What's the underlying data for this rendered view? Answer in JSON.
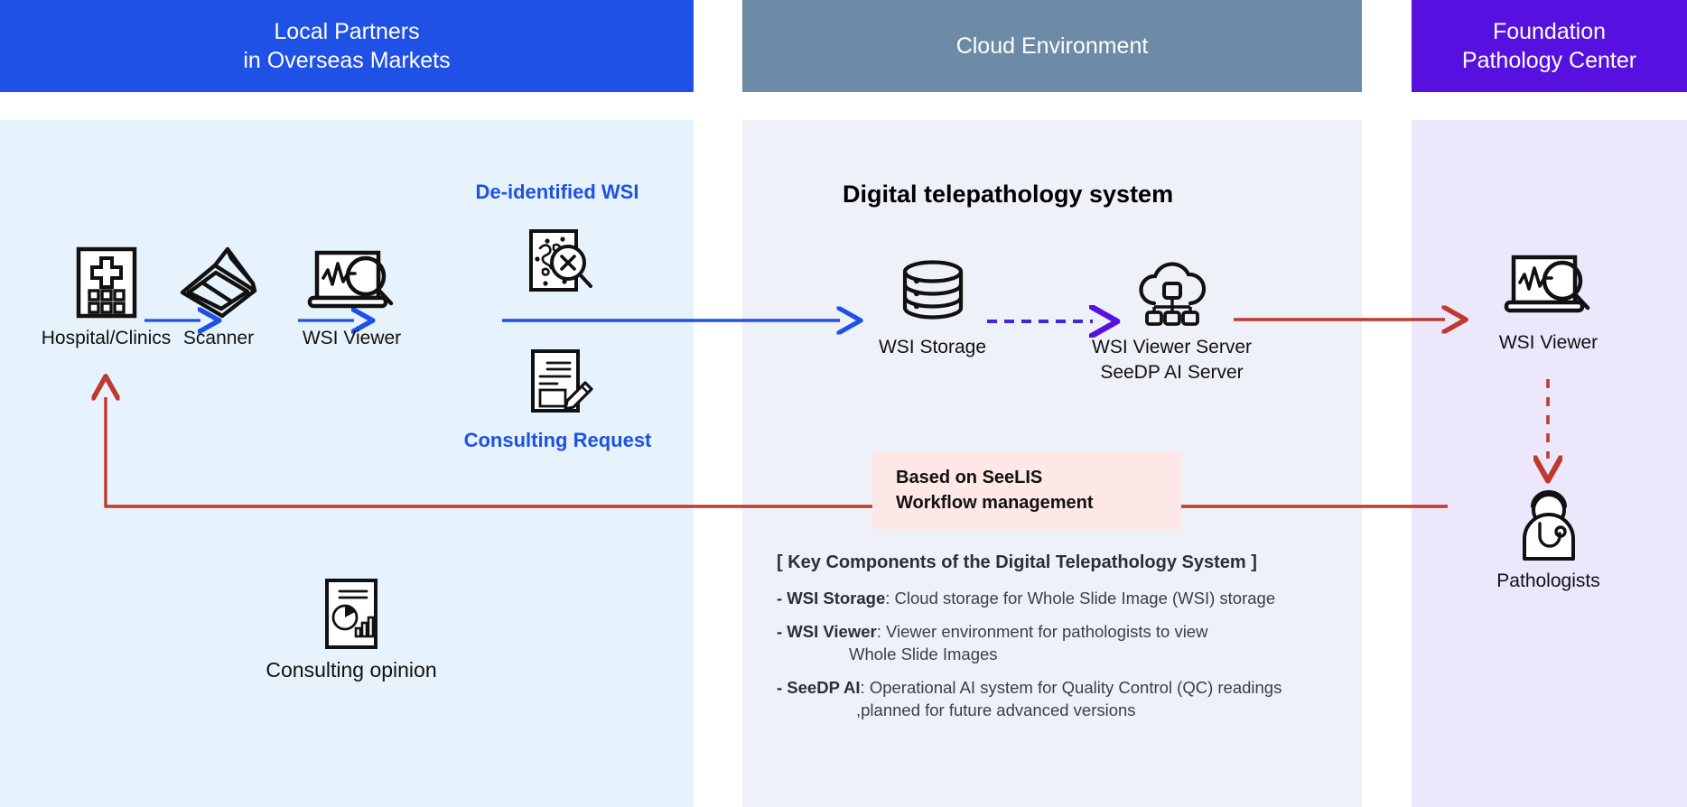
{
  "headers": [
    {
      "id": "local-partners",
      "line1": "Local Partners",
      "line2": "in Overseas Markets",
      "color": "#1f51e6"
    },
    {
      "id": "cloud-environment",
      "line1": "Cloud Environment",
      "line2": "",
      "color": "#6d8aa6"
    },
    {
      "id": "foundation-pathology-center",
      "line1": "Foundation",
      "line2": "Pathology Center",
      "color": "#5611e0"
    }
  ],
  "left_panel": {
    "nodes": [
      {
        "id": "hospital-clinics",
        "label": "Hospital/Clinics",
        "icon": "hospital-icon"
      },
      {
        "id": "scanner",
        "label": "Scanner",
        "icon": "scanner-icon"
      },
      {
        "id": "wsi-viewer",
        "label": "WSI Viewer",
        "icon": "wsi-viewer-icon"
      },
      {
        "id": "consulting-opinion",
        "label": "Consulting opinion",
        "icon": "report-chart-icon"
      }
    ],
    "flow_labels": {
      "deidentified": "De-identified WSI",
      "consulting_request": "Consulting Request"
    },
    "flow_icons": [
      {
        "id": "deidentified-wsi",
        "icon": "slide-anonymize-icon"
      },
      {
        "id": "consulting-request",
        "icon": "document-pen-icon"
      }
    ]
  },
  "center_panel": {
    "title": "Digital telepathology system",
    "nodes": [
      {
        "id": "wsi-storage",
        "label": "WSI Storage",
        "icon": "database-icon"
      },
      {
        "id": "wsi-viewer-server",
        "label_line1": "WSI Viewer Server",
        "label_line2": "SeeDP AI Server",
        "icon": "cloud-server-icon"
      }
    ],
    "pink_box": {
      "line1": "Based on SeeLIS",
      "line2": "Workflow management",
      "bg": "#fde8e7"
    },
    "key_components": {
      "title": "[ Key Components of the Digital Telepathology System ]",
      "items": [
        {
          "term": "- WSI Storage",
          "desc": ": Cloud storage for Whole Slide Image (WSI) storage",
          "cont": ""
        },
        {
          "term": "- WSI Viewer",
          "desc": ": Viewer environment for pathologists to view",
          "cont": "Whole Slide Images"
        },
        {
          "term": "- SeeDP AI",
          "desc": ": Operational AI system for Quality Control (QC) readings",
          "cont": ",planned for future advanced versions"
        }
      ]
    }
  },
  "right_panel": {
    "nodes": [
      {
        "id": "wsi-viewer-right",
        "label": "WSI Viewer",
        "icon": "wsi-viewer-icon"
      },
      {
        "id": "pathologists",
        "label": "Pathologists",
        "icon": "pathologist-icon"
      }
    ]
  },
  "colors": {
    "blue_accent": "#1f51e6",
    "red_accent": "#c0392f",
    "purple_accent": "#5611e0",
    "panel_left": "#e6f3fc",
    "panel_center": "#eef1f7",
    "panel_right": "#ece7fb"
  }
}
